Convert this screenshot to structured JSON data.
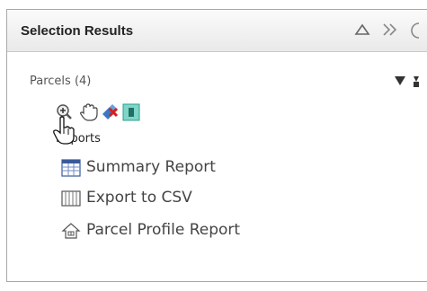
{
  "panel": {
    "title": "Selection Results"
  },
  "header_icons": [
    "collapse-icon",
    "expand-double-icon",
    "more-icon"
  ],
  "results": {
    "group_label": "Parcels (4)"
  },
  "toolbar": {
    "icons": [
      "zoom-to-icon",
      "pan-hand-icon",
      "clear-selection-icon",
      "highlight-icon"
    ],
    "tooltip_text": "Reports"
  },
  "reports": [
    {
      "label": "Summary Report",
      "icon": "summary-report-icon"
    },
    {
      "label": "Export to CSV",
      "icon": "export-csv-icon"
    },
    {
      "label": "Parcel Profile Report",
      "icon": "parcel-profile-icon"
    }
  ]
}
